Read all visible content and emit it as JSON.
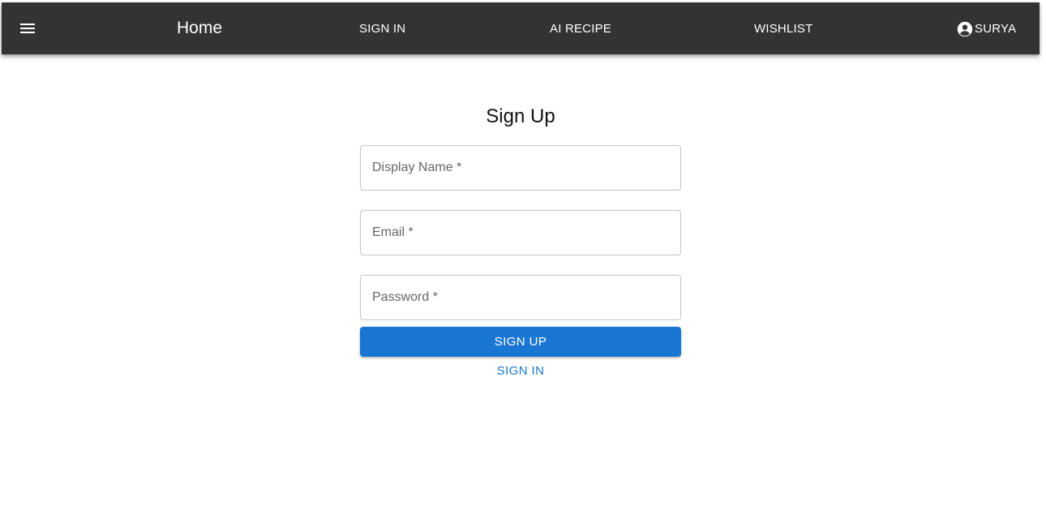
{
  "appbar": {
    "menu_icon": "hamburger-menu-icon",
    "home_label": "Home",
    "nav_items": [
      {
        "label": "SIGN IN"
      },
      {
        "label": "AI RECIPE"
      },
      {
        "label": "WISHLIST"
      }
    ],
    "user": {
      "icon": "account-circle-icon",
      "name": "SURYA"
    },
    "background_color": "#333333"
  },
  "form": {
    "title": "Sign Up",
    "fields": {
      "display_name": {
        "placeholder": "Display Name *",
        "value": ""
      },
      "email": {
        "placeholder": "Email *",
        "value": ""
      },
      "password": {
        "placeholder": "Password *",
        "value": ""
      }
    },
    "submit_label": "SIGN UP",
    "signin_link_label": "SIGN IN",
    "accent_color": "#1976d2"
  }
}
